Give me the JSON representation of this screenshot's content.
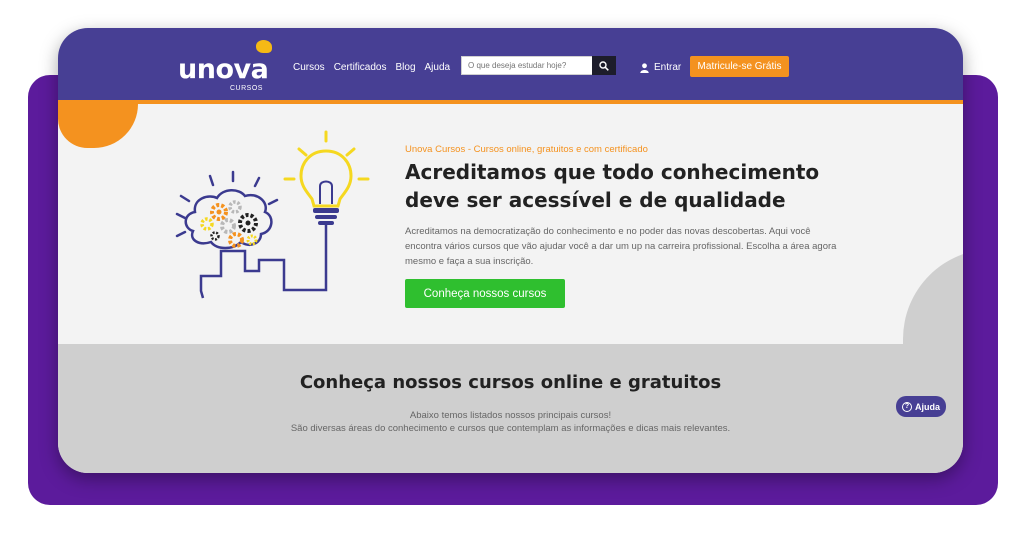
{
  "brand": {
    "name": "unova",
    "sub": "CURSOS"
  },
  "nav": {
    "items": [
      "Cursos",
      "Certificados",
      "Blog",
      "Ajuda"
    ]
  },
  "search": {
    "placeholder": "O que deseja estudar hoje?"
  },
  "header": {
    "login_label": "Entrar",
    "enroll_label": "Matricule-se Grátis"
  },
  "hero": {
    "kicker": "Unova Cursos - Cursos online, gratuitos e com certificado",
    "headline": "Acreditamos que todo conhecimento deve ser acessível e de qualidade",
    "paragraph": "Acreditamos na democratização do conhecimento e no poder das novas descobertas. Aqui você encontra vários cursos que vão ajudar você a dar um up na carreira profissional. Escolha a área agora mesmo e faça a sua inscrição.",
    "cta_label": "Conheça nossos cursos"
  },
  "courses": {
    "title": "Conheça nossos cursos online e gratuitos",
    "line1": "Abaixo temos listados nossos principais cursos!",
    "line2": "São diversas áreas do conhecimento e cursos que contemplam as informações e dicas mais relevantes."
  },
  "help": {
    "label": "Ajuda"
  },
  "colors": {
    "header": "#473f94",
    "accent": "#f4921f",
    "cta": "#2fbf2f",
    "backdrop": "#5c1b9c"
  },
  "icons": [
    "search-icon",
    "user-icon",
    "lightbulb-icon",
    "gears-icon",
    "help-icon"
  ]
}
